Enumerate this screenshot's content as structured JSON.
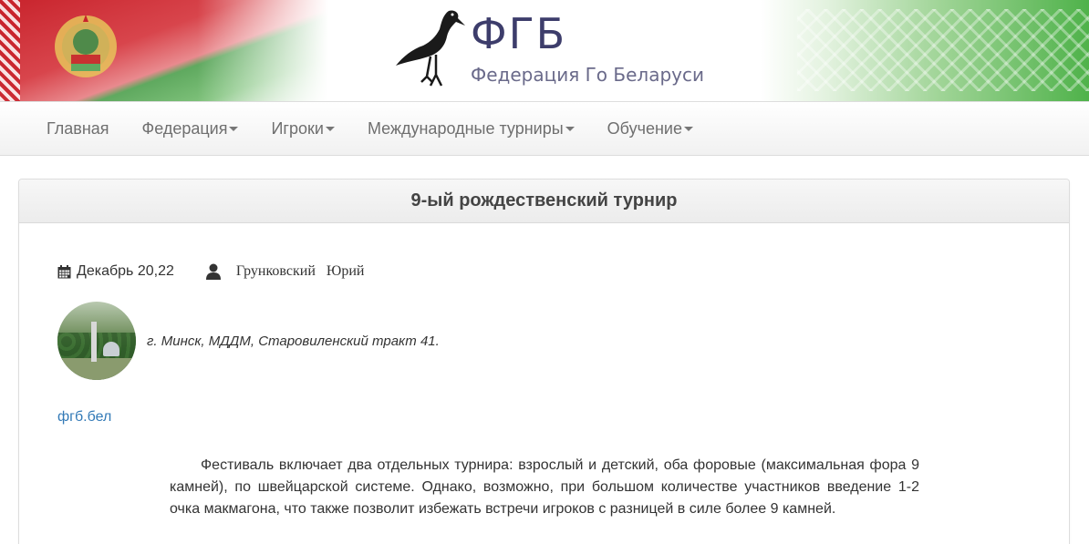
{
  "header": {
    "logo_abbr": "ФГБ",
    "logo_name": "Федерация Го Беларуси",
    "colors": {
      "flag_red": "#c8232c",
      "flag_green": "#4fb24a",
      "logo": "#3d3d6b"
    }
  },
  "nav": {
    "items": [
      {
        "label": "Главная",
        "has_dropdown": false
      },
      {
        "label": "Федерация",
        "has_dropdown": true
      },
      {
        "label": "Игроки",
        "has_dropdown": true
      },
      {
        "label": "Международные турниры",
        "has_dropdown": true
      },
      {
        "label": "Обучение",
        "has_dropdown": true
      }
    ]
  },
  "article": {
    "title": "9-ый рождественский турнир",
    "date": "Декабрь 20,22",
    "author": "Грунковский   Юрий",
    "venue": "г. Минск, МДДМ, Старовиленский тракт 41.",
    "link_text": "фгб.бел",
    "paragraph": "Фестиваль включает два отдельных турнира: взрослый и детский, оба форовые (максимальная фора 9 камней), по швейцарской системе. Однако, возможно, при большом количестве участников введение 1-2 очка макмагона, что также позволит избежать встречи игроков с разницей в силе более 9 камней.",
    "link_color": "#337ab7"
  }
}
